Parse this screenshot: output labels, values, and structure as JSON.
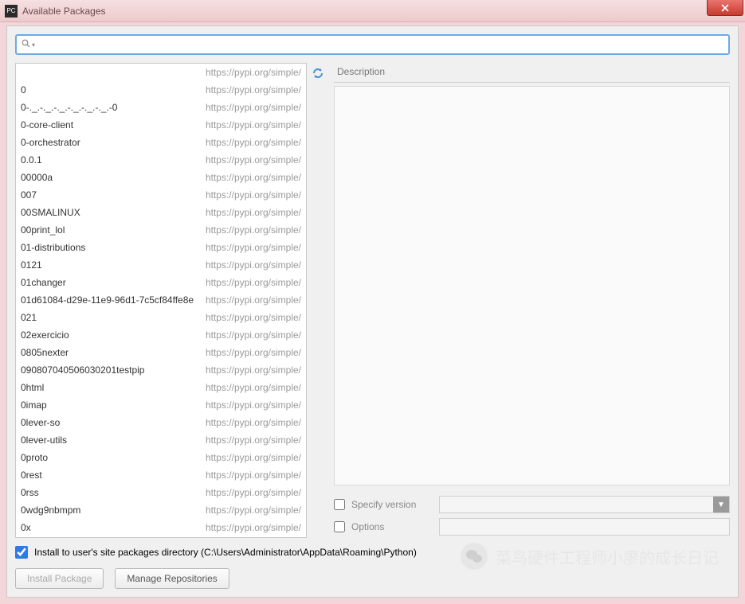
{
  "window": {
    "title": "Available Packages",
    "app_icon_text": "PC"
  },
  "search": {
    "value": "",
    "placeholder": ""
  },
  "packages_source": "https://pypi.org/simple/",
  "packages": [
    {
      "name": ""
    },
    {
      "name": "0"
    },
    {
      "name": "0-._.-._.-._.-._.-._.-._.-0"
    },
    {
      "name": "0-core-client"
    },
    {
      "name": "0-orchestrator"
    },
    {
      "name": "0.0.1"
    },
    {
      "name": "00000a"
    },
    {
      "name": "007"
    },
    {
      "name": "00SMALINUX"
    },
    {
      "name": "00print_lol"
    },
    {
      "name": "01-distributions"
    },
    {
      "name": "0121"
    },
    {
      "name": "01changer"
    },
    {
      "name": "01d61084-d29e-11e9-96d1-7c5cf84ffe8e"
    },
    {
      "name": "021"
    },
    {
      "name": "02exercicio"
    },
    {
      "name": "0805nexter"
    },
    {
      "name": "090807040506030201testpip"
    },
    {
      "name": "0html"
    },
    {
      "name": "0imap"
    },
    {
      "name": "0lever-so"
    },
    {
      "name": "0lever-utils"
    },
    {
      "name": "0proto"
    },
    {
      "name": "0rest"
    },
    {
      "name": "0rss"
    },
    {
      "name": "0wdg9nbmpm"
    },
    {
      "name": "0x"
    }
  ],
  "right_panel": {
    "description_label": "Description",
    "specify_version_label": "Specify version",
    "specify_version_checked": false,
    "specify_version_value": "",
    "options_label": "Options",
    "options_checked": false,
    "options_value": ""
  },
  "install_to_user": {
    "checked": true,
    "label": "Install to user's site packages directory (C:\\Users\\Administrator\\AppData\\Roaming\\Python)"
  },
  "buttons": {
    "install_package": "Install Package",
    "manage_repositories": "Manage Repositories"
  },
  "watermark": {
    "text": "菜鸟硬件工程师小廖的成长日记"
  }
}
